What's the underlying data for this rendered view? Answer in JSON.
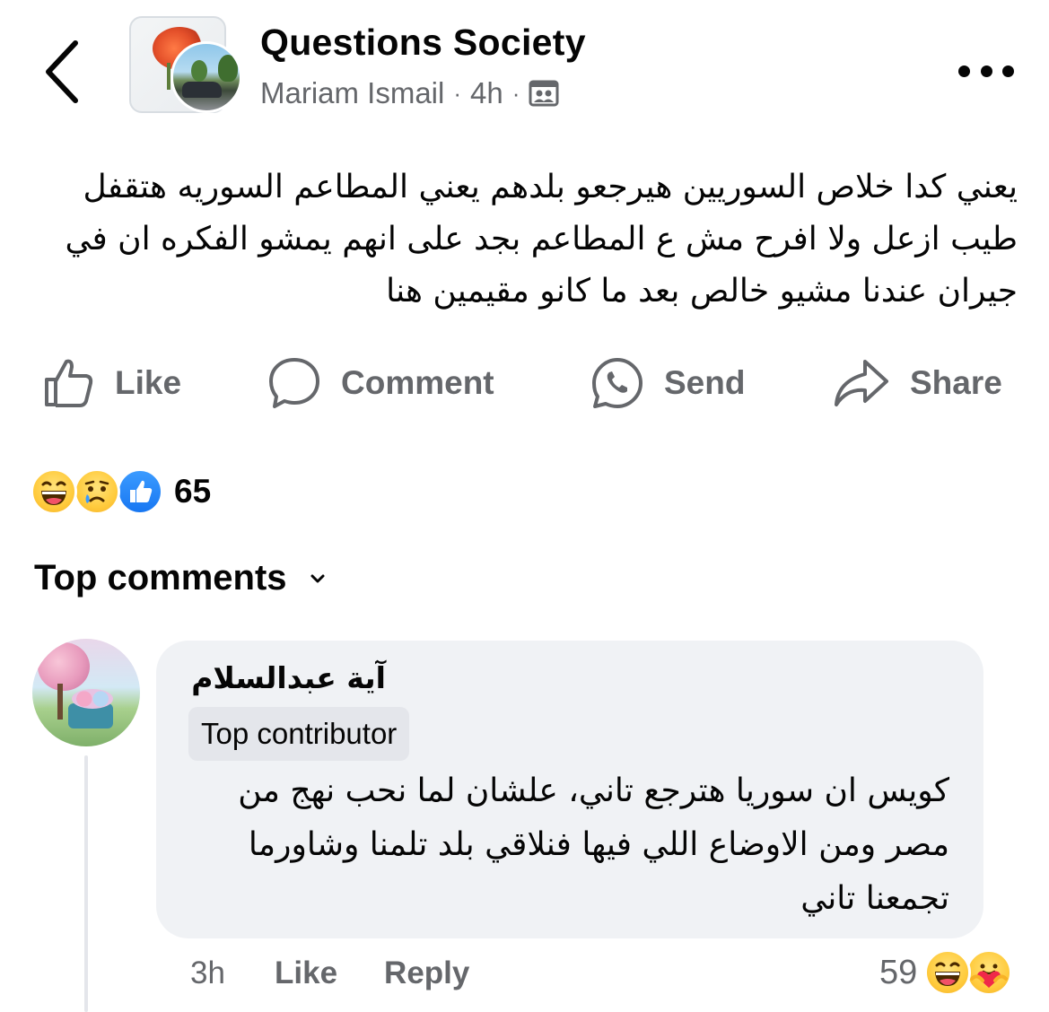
{
  "header": {
    "group_name": "Questions Society",
    "author": "Mariam Ismail",
    "time": "4h",
    "separator": "·",
    "privacy_icon": "group-members-icon"
  },
  "post": {
    "text": "يعني كدا خلاص السوريين هيرجعو بلدهم يعني المطاعم السوريه هتقفل طيب ازعل ولا افرح مش ع المطاعم بجد على انهم يمشو الفكره ان في جيران عندنا مشيو خالص بعد ما كانو مقيمين هنا"
  },
  "actions": {
    "like": "Like",
    "comment": "Comment",
    "send": "Send",
    "share": "Share"
  },
  "reactions": {
    "types": [
      "haha",
      "sad",
      "like"
    ],
    "count": "65"
  },
  "comments_section": {
    "label": "Top comments"
  },
  "comment": {
    "author": "آية عبدالسلام",
    "badge": "Top contributor",
    "text": "كويس ان سوريا هترجع تاني، علشان لما نحب نهج من مصر ومن الاوضاع اللي فيها فنلاقي بلد تلمنا وشاورما تجمعنا تاني",
    "time": "3h",
    "like_label": "Like",
    "reply_label": "Reply",
    "reaction_count": "59",
    "reaction_types": [
      "haha",
      "care"
    ]
  },
  "colors": {
    "text_primary": "#050505",
    "text_secondary": "#65676b",
    "bubble_bg": "#f0f2f5",
    "badge_bg": "#e4e6eb",
    "like_blue": "#1877f2"
  }
}
